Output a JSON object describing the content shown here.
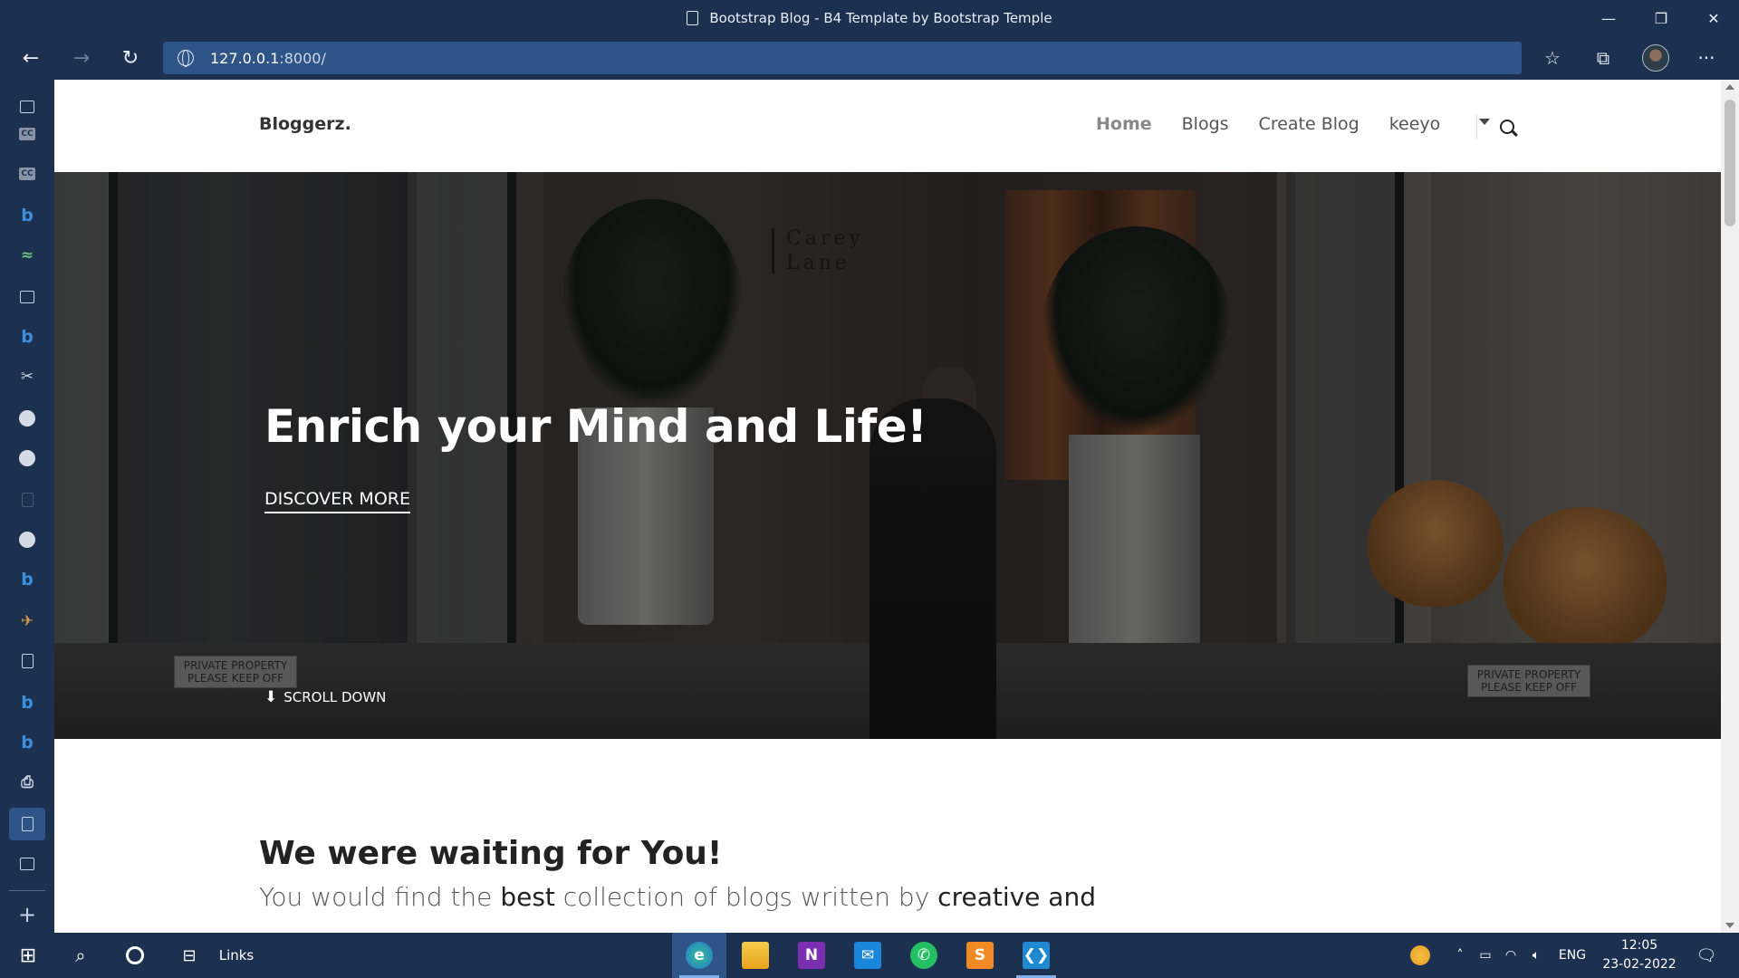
{
  "browser": {
    "tab_title": "Bootstrap Blog - B4 Template by Bootstrap Temple",
    "url_host": "127.0.0.1",
    "url_rest": ":8000/",
    "icons": {
      "back": "back-arrow-icon",
      "forward": "forward-arrow-icon",
      "reload": "reload-icon",
      "favorites": "favorites-star-icon",
      "collections": "collections-icon",
      "profile": "profile-avatar",
      "more": "more-ellipsis-icon"
    },
    "window_controls": [
      "minimize",
      "restore",
      "close"
    ]
  },
  "vertical_tabs": [
    {
      "name": "tab-actions-icon"
    },
    {
      "name": "cc-tab-icon",
      "glyph": "CC"
    },
    {
      "name": "cc-tab-icon",
      "glyph": "CC"
    },
    {
      "name": "bing-tab-icon",
      "glyph": "b"
    },
    {
      "name": "link-tab-icon",
      "glyph": "≈"
    },
    {
      "name": "window-tab-icon"
    },
    {
      "name": "bing-tab-icon",
      "glyph": "b"
    },
    {
      "name": "scissors-tab-icon",
      "glyph": "✂"
    },
    {
      "name": "github-tab-icon"
    },
    {
      "name": "github-tab-icon"
    },
    {
      "name": "blank-tab-icon"
    },
    {
      "name": "github-tab-icon"
    },
    {
      "name": "bing-tab-icon",
      "glyph": "b"
    },
    {
      "name": "rocket-tab-icon",
      "glyph": "✈"
    },
    {
      "name": "page-tab-icon"
    },
    {
      "name": "bing-tab-icon",
      "glyph": "b"
    },
    {
      "name": "bing-tab-icon",
      "glyph": "b"
    },
    {
      "name": "printer-tab-icon",
      "glyph": "⎙"
    },
    {
      "name": "page-tab-icon",
      "active": true
    },
    {
      "name": "window-tab-icon"
    },
    {
      "name": "new-tab-icon",
      "glyph": "+"
    }
  ],
  "site": {
    "brand": "Bloggerz.",
    "nav": {
      "home": "Home",
      "blogs": "Blogs",
      "create": "Create Blog",
      "user": "keeyo"
    },
    "hero": {
      "heading": "Enrich your Mind and Life!",
      "cta": "DISCOVER MORE",
      "scroll": "SCROLL DOWN",
      "sign_line1": "Carey",
      "sign_line2": "Lane",
      "keepoff_left": "PRIVATE PROPERTY PLEASE KEEP OFF",
      "keepoff_right": "PRIVATE PROPERTY PLEASE KEEP OFF"
    },
    "intro": {
      "heading": "We were waiting for You!",
      "text_1": "You would find the ",
      "text_bold_1": "best",
      "text_2": " collection of blogs written by ",
      "text_bold_2": "creative and"
    }
  },
  "taskbar": {
    "links_label": "Links",
    "apps": [
      "edge",
      "file-explorer",
      "onenote",
      "mail",
      "whatsapp",
      "sublime-text",
      "vscode"
    ],
    "lang": "ENG",
    "time": "12:05",
    "date": "23-02-2022"
  },
  "colors": {
    "chrome": "#1c3050",
    "accent": "#2e5488"
  }
}
